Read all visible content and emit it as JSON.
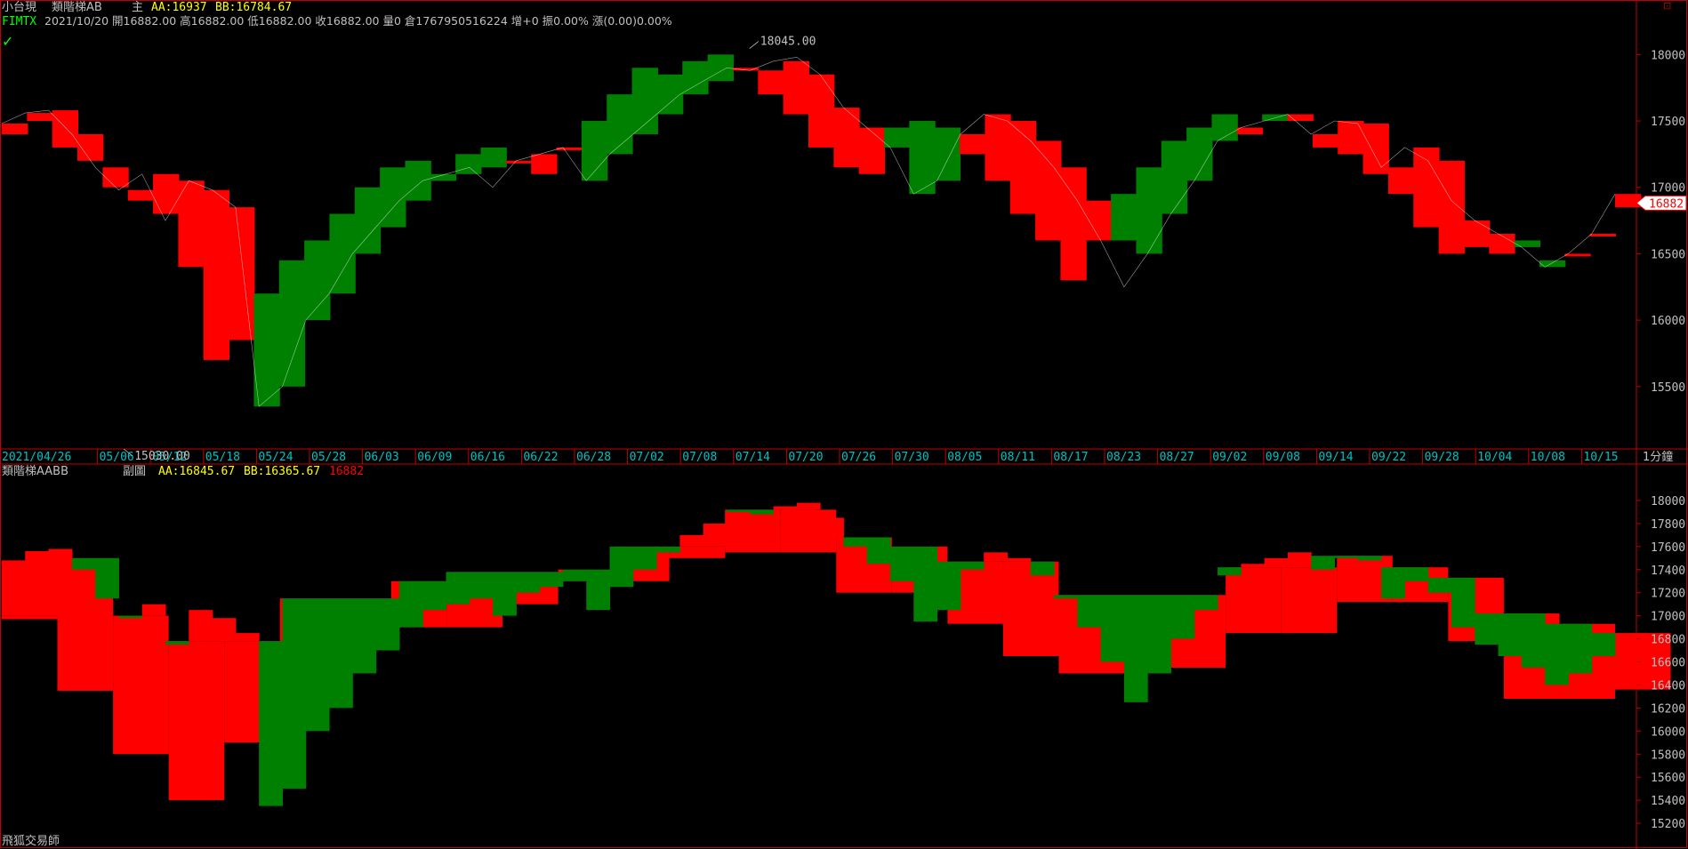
{
  "app": {
    "symbol_name": "小台現",
    "main_indicator_name": "類階梯AB",
    "main_label": "主",
    "main_aa": "AA:16937",
    "main_bb": "BB:16784.67",
    "instrument_code": "FIMTX",
    "quote_line": "2021/10/20 開16882.00 高16882.00 低16882.00 收16882.00 量0 倉1767950516224 增+0 振0.00% 漲(0.00)0.00%",
    "sub_indicator_name": "類階梯AABB",
    "sub_label": "副圖",
    "sub_aa": "AA:16845.67",
    "sub_bb": "BB:16365.67",
    "sub_last": "16882",
    "timeframe": "1分鐘",
    "watermark": "飛狐交易師",
    "check_icon": "checkmark-icon",
    "close_icon": "close-icon"
  },
  "colors": {
    "up": "#ff0000",
    "down": "#008000",
    "background": "#000000",
    "axis": "#c00000",
    "axis_text_top": "#c0c0c0",
    "date_text": "#00c0c0",
    "aa_color": "#ffff00",
    "code_color": "#00ff00"
  },
  "chart_data": [
    {
      "type": "area",
      "name": "main",
      "ylim": [
        15030,
        18250
      ],
      "yticks": [
        15500,
        16000,
        16500,
        17000,
        17500,
        18000
      ],
      "last_price_label": "16882",
      "annotations": [
        {
          "text": "18045.00",
          "date": "07/14",
          "value": 18045
        },
        {
          "text": "15030.00",
          "date": "05/12",
          "value": 15030
        }
      ],
      "x_dates": [
        "2021/04/26",
        "05/06",
        "05/12",
        "05/18",
        "05/24",
        "05/28",
        "06/03",
        "06/09",
        "06/16",
        "06/22",
        "06/28",
        "07/02",
        "07/08",
        "07/14",
        "07/20",
        "07/26",
        "07/30",
        "08/05",
        "08/11",
        "08/17",
        "08/23",
        "08/27",
        "09/02",
        "09/08",
        "09/14",
        "09/22",
        "09/28",
        "10/04",
        "10/08",
        "10/15"
      ],
      "close": [
        17480,
        17560,
        17580,
        17400,
        17150,
        16980,
        17100,
        16750,
        17050,
        16980,
        16850,
        15350,
        15500,
        16000,
        16200,
        16500,
        16700,
        16900,
        17050,
        17100,
        17150,
        17000,
        17200,
        17250,
        17300,
        17050,
        17250,
        17400,
        17550,
        17700,
        17800,
        17900,
        17880,
        17950,
        17980,
        17850,
        17600,
        17450,
        17300,
        16950,
        17050,
        17400,
        17550,
        17500,
        17350,
        17150,
        16900,
        16600,
        16250,
        16500,
        16800,
        17050,
        17350,
        17450,
        17500,
        17550,
        17400,
        17500,
        17480,
        17150,
        17300,
        17200,
        16900,
        16750,
        16650,
        16550,
        16400,
        16500,
        16650,
        16950
      ],
      "level_a": [
        17400,
        17500,
        17300,
        17200,
        17000,
        16900,
        16800,
        16400,
        15700,
        15850,
        16200,
        16450,
        16600,
        16800,
        17000,
        17150,
        17200,
        17100,
        17250,
        17300,
        17200,
        17100,
        17300,
        17500,
        17700,
        17900,
        17850,
        17950,
        18000,
        17900,
        17700,
        17550,
        17300,
        17150,
        17100,
        17450,
        17500,
        17450,
        17250,
        17050,
        16800,
        16600,
        16300,
        16600,
        16950,
        17150,
        17350,
        17450,
        17550,
        17400,
        17550,
        17500,
        17300,
        17250,
        17100,
        16950,
        16700,
        16500,
        16550,
        16500,
        16600,
        16450,
        16500,
        16650,
        16850
      ]
    },
    {
      "type": "area",
      "name": "sub",
      "ylim": [
        15000,
        18100
      ],
      "yticks": [
        15200,
        15400,
        15600,
        15800,
        16000,
        16200,
        16400,
        16600,
        16800,
        17000,
        17200,
        17400,
        17600,
        17800,
        18000
      ],
      "close": [
        17480,
        17560,
        17580,
        17400,
        17150,
        16980,
        17100,
        16750,
        17050,
        16980,
        16850,
        15350,
        15500,
        16000,
        16200,
        16500,
        16700,
        16900,
        17050,
        17100,
        17150,
        17000,
        17200,
        17250,
        17300,
        17050,
        17250,
        17400,
        17550,
        17700,
        17800,
        17900,
        17880,
        17950,
        17980,
        17850,
        17600,
        17450,
        17300,
        16950,
        17050,
        17400,
        17550,
        17500,
        17350,
        17150,
        16900,
        16600,
        16250,
        16500,
        16800,
        17050,
        17350,
        17450,
        17500,
        17550,
        17400,
        17500,
        17480,
        17150,
        17300,
        17200,
        16900,
        16750,
        16650,
        16550,
        16400,
        16500,
        16650,
        16950
      ],
      "steps": [
        {
          "from": "2021/04/26",
          "upper": 17000,
          "lower": 16970
        },
        {
          "from": "05/06",
          "upper": 17500,
          "lower": 16350
        },
        {
          "from": "05/12",
          "upper": 17000,
          "lower": 15800
        },
        {
          "from": "05/18",
          "upper": 16780,
          "lower": 15400
        },
        {
          "from": "05/24",
          "upper": 16780,
          "lower": 15900
        },
        {
          "from": "05/28",
          "upper": 17150,
          "lower": 16500
        },
        {
          "from": "06/03",
          "upper": 17150,
          "lower": 16800
        },
        {
          "from": "06/09",
          "upper": 17300,
          "lower": 16900
        },
        {
          "from": "06/16",
          "upper": 17380,
          "lower": 16900
        },
        {
          "from": "06/22",
          "upper": 17380,
          "lower": 17100
        },
        {
          "from": "06/28",
          "upper": 17400,
          "lower": 17300
        },
        {
          "from": "07/02",
          "upper": 17600,
          "lower": 17300
        },
        {
          "from": "07/08",
          "upper": 17600,
          "lower": 17500
        },
        {
          "from": "07/14",
          "upper": 17920,
          "lower": 17550
        },
        {
          "from": "07/20",
          "upper": 17920,
          "lower": 17550
        },
        {
          "from": "07/26",
          "upper": 17680,
          "lower": 17200
        },
        {
          "from": "07/30",
          "upper": 17600,
          "lower": 17200
        },
        {
          "from": "08/05",
          "upper": 17470,
          "lower": 16930
        },
        {
          "from": "08/11",
          "upper": 17470,
          "lower": 16650
        },
        {
          "from": "08/17",
          "upper": 17180,
          "lower": 16500
        },
        {
          "from": "08/23",
          "upper": 17180,
          "lower": 16500
        },
        {
          "from": "08/27",
          "upper": 17180,
          "lower": 16550
        },
        {
          "from": "09/02",
          "upper": 17420,
          "lower": 16850
        },
        {
          "from": "09/08",
          "upper": 17420,
          "lower": 16850
        },
        {
          "from": "09/14",
          "upper": 17520,
          "lower": 17120
        },
        {
          "from": "09/22",
          "upper": 17420,
          "lower": 17120
        },
        {
          "from": "09/28",
          "upper": 17330,
          "lower": 16780
        },
        {
          "from": "10/04",
          "upper": 17020,
          "lower": 16280
        },
        {
          "from": "10/08",
          "upper": 16930,
          "lower": 16280
        },
        {
          "from": "10/15",
          "upper": 16850,
          "lower": 16360
        }
      ]
    }
  ]
}
